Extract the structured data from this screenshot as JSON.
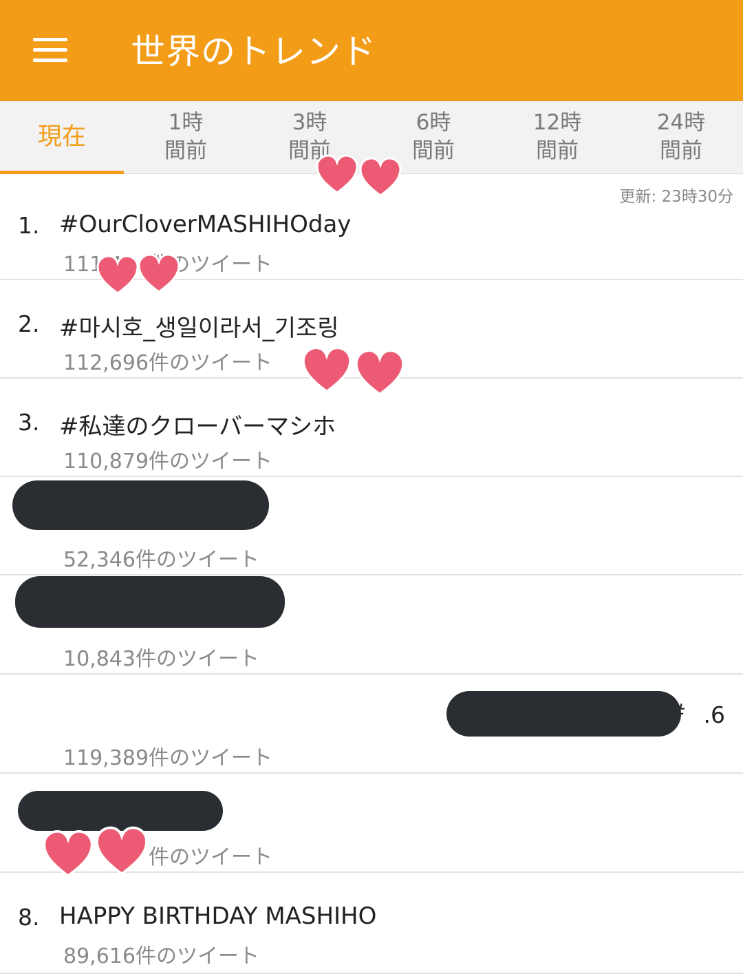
{
  "app": {
    "title": "世界のトレンド"
  },
  "tabs": [
    {
      "label": "現在",
      "active": true
    },
    {
      "label": "1時\n間前",
      "active": false
    },
    {
      "label": "3時\n間前",
      "active": false
    },
    {
      "label": "6時\n間前",
      "active": false
    },
    {
      "label": "12時\n間前",
      "active": false
    },
    {
      "label": "24時\n間前",
      "active": false
    }
  ],
  "updated": "更新: 23時30分",
  "trends": [
    {
      "rank": "1.",
      "name": "#OurCloverMASHIHOday",
      "count": "111,434件のツイート"
    },
    {
      "rank": "2.",
      "name": "#마시호_생일이라서_기조링",
      "count": "112,696件のツイート"
    },
    {
      "rank": "3.",
      "name": "#私達のクローバーマシホ",
      "count": "110,879件のツイート"
    },
    {
      "rank": "",
      "name": "",
      "count": "52,346件のツイート"
    },
    {
      "rank": "",
      "name": "",
      "count": "10,843件のツイート"
    },
    {
      "rank": ".6",
      "name": "#",
      "count": "119,389件のツイート"
    },
    {
      "rank": "",
      "name": "",
      "count": "件のツイート"
    },
    {
      "rank": "8.",
      "name": "HAPPY BIRTHDAY MASHIHO",
      "count": "89,616件のツイート"
    }
  ],
  "colors": {
    "accent": "#f39c17",
    "tab_bar": "#f2f2f2",
    "redaction": "#2a2d31",
    "heart": "#ec5b73"
  },
  "icons": [
    "menu-icon",
    "heart-icon"
  ]
}
